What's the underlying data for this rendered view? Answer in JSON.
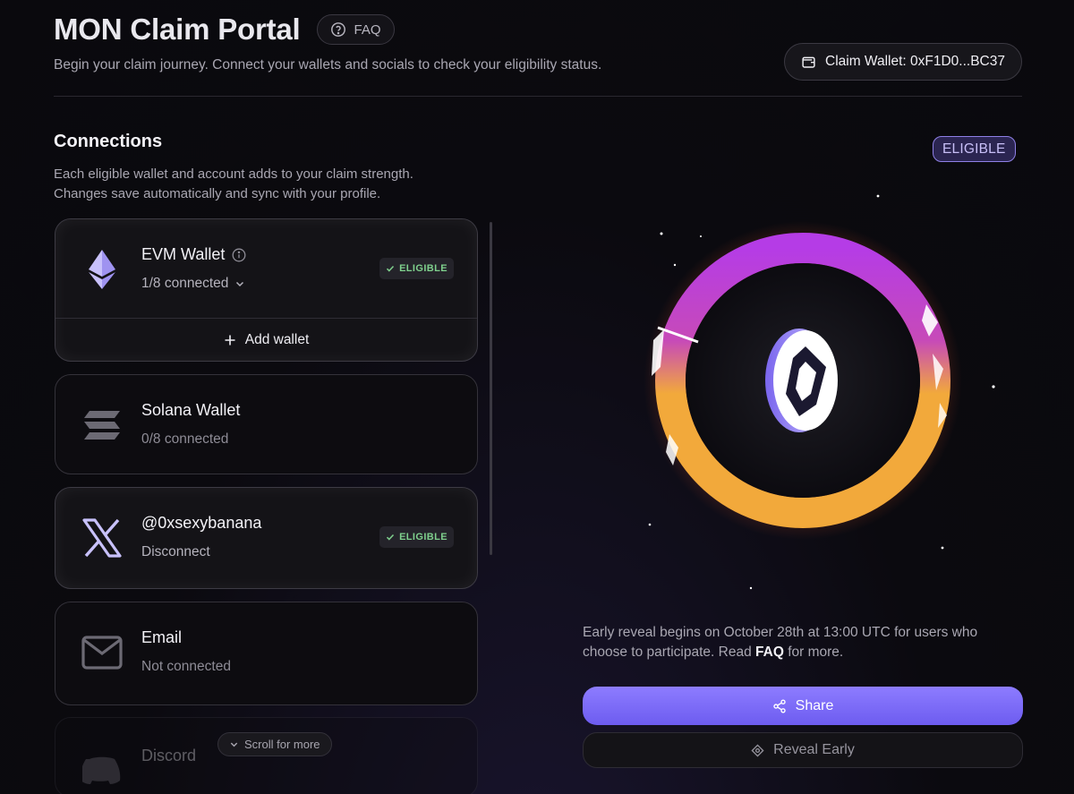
{
  "header": {
    "title": "MON Claim Portal",
    "faq_label": "FAQ",
    "subtitle": "Begin your claim journey. Connect your wallets and socials to check your eligibility status.",
    "claim_wallet_label": "Claim Wallet: 0xF1D0...BC37"
  },
  "connections": {
    "title": "Connections",
    "desc_line1": "Each eligible wallet and account adds to your claim strength.",
    "desc_line2": "Changes save automatically and sync with your profile.",
    "items": [
      {
        "name": "EVM Wallet",
        "status": "1/8 connected",
        "badge": "ELIGIBLE",
        "icon": "ethereum-icon",
        "action": "Add wallet"
      },
      {
        "name": "Solana Wallet",
        "status": "0/8 connected",
        "icon": "solana-icon"
      },
      {
        "name": "@0xsexybanana",
        "status": "Disconnect",
        "badge": "ELIGIBLE",
        "icon": "x-icon"
      },
      {
        "name": "Email",
        "status": "Not connected",
        "icon": "mail-icon"
      },
      {
        "name": "Discord",
        "icon": "discord-icon"
      }
    ],
    "scroll_more": "Scroll for more"
  },
  "status": {
    "eligible_label": "ELIGIBLE",
    "reveal_text_before": "Early reveal begins on October 28th at 13:00 UTC for users who choose to participate. Read ",
    "reveal_text_link": "FAQ",
    "reveal_text_after": " for more.",
    "share_label": "Share",
    "reveal_early_label": "Reveal Early"
  },
  "colors": {
    "accent": "#7c6cf7",
    "eligible_green": "#7fd08d",
    "ring_purple": "#b53ce6",
    "ring_orange": "#f2a93b"
  }
}
